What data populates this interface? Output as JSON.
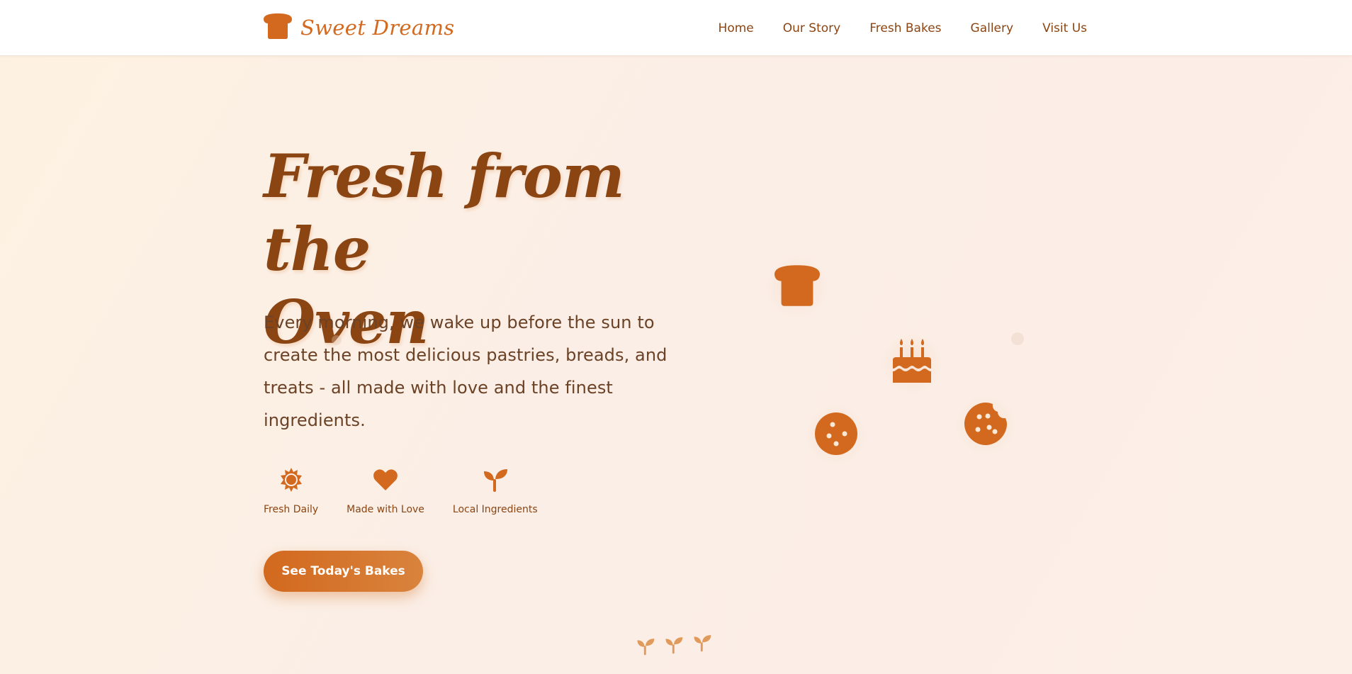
{
  "brand": {
    "name": "Sweet Dreams",
    "icon": "bread-icon"
  },
  "nav": {
    "items": [
      {
        "label": "Home"
      },
      {
        "label": "Our Story"
      },
      {
        "label": "Fresh Bakes"
      },
      {
        "label": "Gallery"
      },
      {
        "label": "Visit Us"
      }
    ]
  },
  "hero": {
    "title_line1": "Fresh from the",
    "title_line2": "Oven",
    "description": "Every morning, we wake up before the sun to create the most delicious pastries, breads, and treats - all made with love and the finest ingredients.",
    "features": [
      {
        "label": "Fresh Daily",
        "icon": "sun-icon"
      },
      {
        "label": "Made with Love",
        "icon": "heart-icon"
      },
      {
        "label": "Local Ingredients",
        "icon": "seedling-icon"
      }
    ],
    "cta_label": "See Today's Bakes"
  },
  "decor": {
    "floating_icons": [
      "bread-icon",
      "birthday-cake-icon",
      "cookie-icon",
      "cookie-bite-icon"
    ],
    "bottom_icons": [
      "seedling-icon",
      "seedling-icon",
      "seedling-icon"
    ]
  },
  "colors": {
    "primary": "#d2691e",
    "heading": "#8b4513",
    "text": "#6b4226",
    "background": "#fdf0e6",
    "nav_background": "#ffffff"
  }
}
